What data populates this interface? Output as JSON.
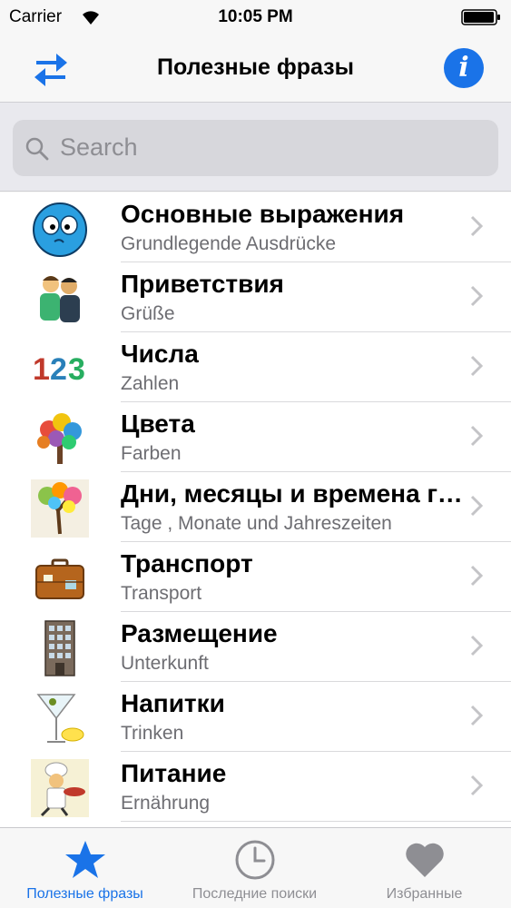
{
  "status_bar": {
    "carrier": "Carrier",
    "time": "10:05 PM"
  },
  "nav": {
    "title": "Полезные фразы",
    "left_icon": "swap-arrows-icon",
    "right_icon": "info-icon",
    "accent_color": "#1a73e8"
  },
  "search": {
    "placeholder": "Search"
  },
  "items": [
    {
      "title": "Основные выражения",
      "subtitle": "Grundlegende Ausdrücke",
      "icon": "smiley-face-icon"
    },
    {
      "title": "Приветствия",
      "subtitle": "Grüße",
      "icon": "greeting-people-icon"
    },
    {
      "title": "Числа",
      "subtitle": "Zahlen",
      "icon": "numbers-icon",
      "icon_text": "123"
    },
    {
      "title": "Цвета",
      "subtitle": "Farben",
      "icon": "colorful-tree-icon"
    },
    {
      "title": "Дни, месяцы и времена года",
      "subtitle": "Tage , Monate und Jahreszeiten",
      "icon": "seasons-tree-icon"
    },
    {
      "title": "Транспорт",
      "subtitle": "Transport",
      "icon": "suitcase-icon"
    },
    {
      "title": "Размещение",
      "subtitle": "Unterkunft",
      "icon": "building-icon"
    },
    {
      "title": "Напитки",
      "subtitle": "Trinken",
      "icon": "cocktail-icon"
    },
    {
      "title": "Питание",
      "subtitle": "Ernährung",
      "icon": "chef-icon"
    }
  ],
  "tabs": [
    {
      "label": "Полезные фразы",
      "icon": "star-icon",
      "active": true
    },
    {
      "label": "Последние поиски",
      "icon": "clock-icon",
      "active": false
    },
    {
      "label": "Избранные",
      "icon": "heart-icon",
      "active": false
    }
  ]
}
